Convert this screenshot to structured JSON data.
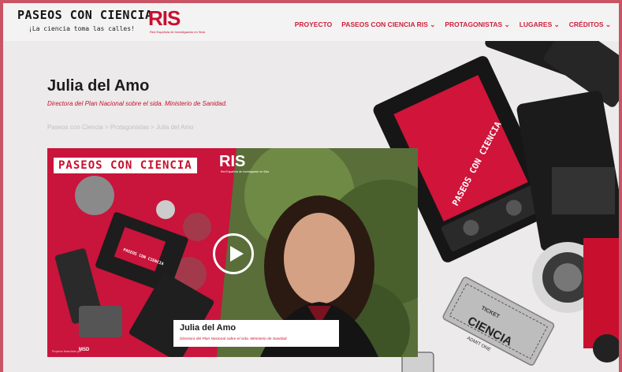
{
  "header": {
    "logo_title": "PASEOS CON CIENCIA",
    "logo_tagline": "¡La ciencia toma las calles!",
    "ris_logo": "RIS",
    "ris_subtitle": "Red Española de Investigación en Sida",
    "nav": [
      {
        "label": "PROYECTO"
      },
      {
        "label": "PASEOS CON CIENCIA RIS ⌄"
      },
      {
        "label": "PROTAGONISTAS ⌄"
      },
      {
        "label": "LUGARES ⌄"
      },
      {
        "label": "CRÉDITOS ⌄"
      }
    ]
  },
  "page": {
    "title": "Julia del Amo",
    "subtitle": "Directora del Plan Nacional sobre el sida. Ministerio de Sanidad.",
    "breadcrumb": [
      "Paseos con Ciencia",
      " > ",
      "Protagonistas",
      " > ",
      "Julia del Amo"
    ]
  },
  "video": {
    "banner": "PASEOS CON CIENCIA",
    "logo": "RIS",
    "logo_sub": "Red Española de Investigación en Sida",
    "tape_label": "PASEOS CON CIENCIA",
    "caption_name": "Julia del Amo",
    "caption_role": "Directora del Plan Nacional sobre el sida. Ministerio de Sanidad.",
    "footer_text": "Proyecto financiado por",
    "footer_logo": "MSD"
  },
  "decor": {
    "tape_label": "PASEOS CON CIENCIA",
    "ticket_top": "TICKET",
    "ticket_main": "CIENCIA",
    "ticket_bottom": "ADMIT ONE"
  },
  "colors": {
    "accent": "#c8102e",
    "frame": "#c85565",
    "background": "#eceaea"
  }
}
